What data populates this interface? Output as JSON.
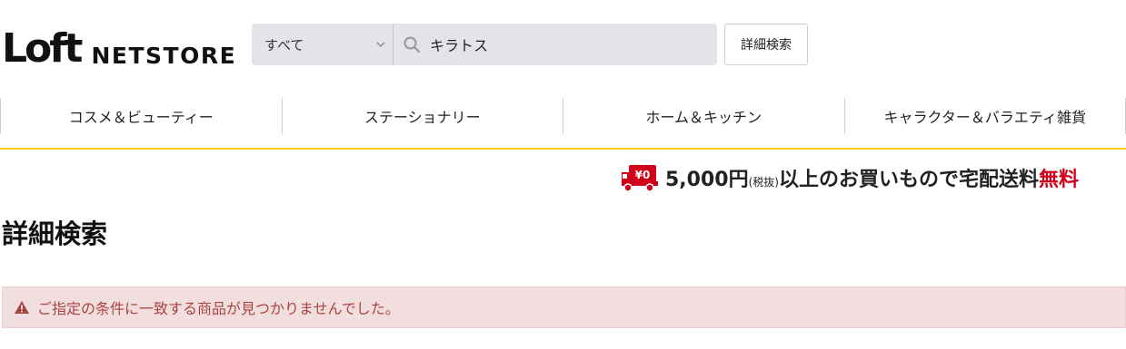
{
  "header": {
    "logo_main": "Loft",
    "logo_sub": "NETSTORE",
    "category_select": "すべて",
    "search_value": "キラトス",
    "advanced_search_label": "詳細検索"
  },
  "nav": {
    "items": [
      {
        "label": "コスメ＆ビューティー"
      },
      {
        "label": "ステーショナリー"
      },
      {
        "label": "ホーム＆キッチン"
      },
      {
        "label": "キャラクター＆バラエティ雑貨"
      }
    ]
  },
  "shipping_banner": {
    "icon": "truck-icon",
    "badge": "¥0",
    "amount": "5,000円",
    "tax_note": "(税抜)",
    "text": "以上のお買いもので宅配送料",
    "free": "無料"
  },
  "page_title": "詳細検索",
  "alert": {
    "icon": "warning-icon",
    "message": "ご指定の条件に一致する商品が見つかりませんでした。"
  },
  "colors": {
    "accent_line": "#f5c518",
    "free_text": "#d0021b",
    "alert_bg": "#f2dede",
    "alert_text": "#a94442"
  }
}
